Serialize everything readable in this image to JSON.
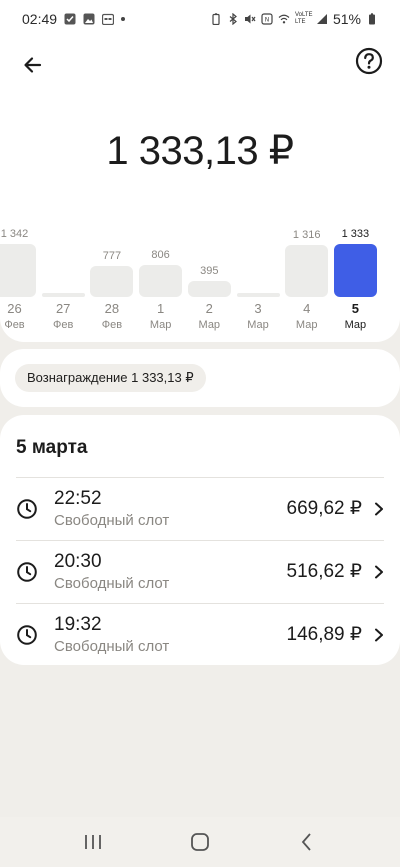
{
  "status_bar": {
    "time": "02:49",
    "battery": "51%",
    "network": "VoLTE LTE"
  },
  "header": {
    "total": "1 333,13 ₽"
  },
  "chart_data": {
    "type": "bar",
    "categories": [
      "26 Фев",
      "27 Фев",
      "28 Фев",
      "1 Мар",
      "2 Мар",
      "3 Мар",
      "4 Мар",
      "5 Мар"
    ],
    "series": [
      {
        "values": [
          1342,
          0,
          777,
          806,
          395,
          0,
          1316,
          1333
        ]
      }
    ],
    "days": [
      "26",
      "27",
      "28",
      "1",
      "2",
      "3",
      "4",
      "5"
    ],
    "months": [
      "Фев",
      "Фев",
      "Фев",
      "Мар",
      "Мар",
      "Мар",
      "Мар",
      "Мар"
    ],
    "value_labels": [
      "1 342",
      "",
      "777",
      "806",
      "395",
      "",
      "1 316",
      "1 333"
    ],
    "selected_index": 7,
    "accent_color": "#3f5ee6",
    "bar_color": "#ececea"
  },
  "reward": {
    "label": "Вознаграждение 1 333,13 ₽"
  },
  "list": {
    "date_title": "5 марта",
    "rows": [
      {
        "time": "22:52",
        "subtitle": "Свободный слот",
        "amount": "669,62 ₽"
      },
      {
        "time": "20:30",
        "subtitle": "Свободный слот",
        "amount": "516,62 ₽"
      },
      {
        "time": "19:32",
        "subtitle": "Свободный слот",
        "amount": "146,89 ₽"
      }
    ]
  }
}
